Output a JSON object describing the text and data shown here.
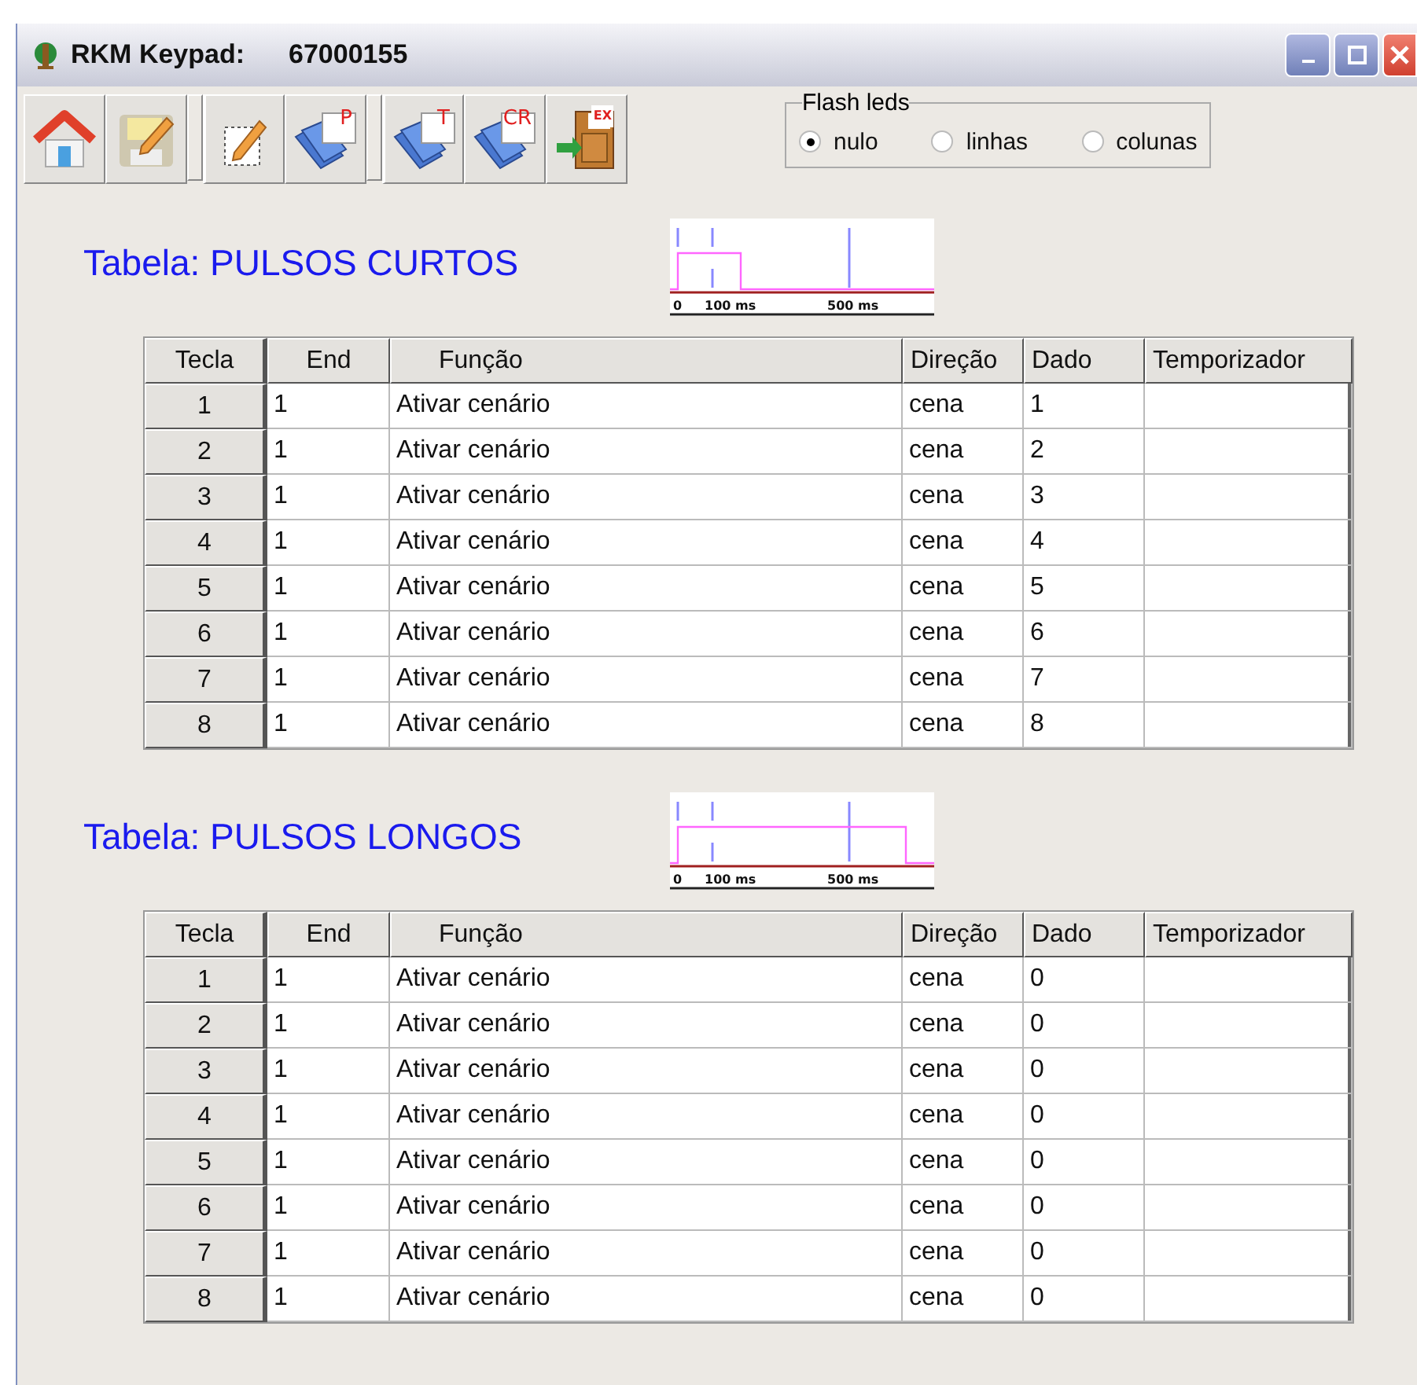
{
  "window": {
    "title": "RKM Keypad:",
    "serial": "67000155"
  },
  "toolbar": [
    {
      "kind": "home",
      "separator_before": false
    },
    {
      "kind": "save",
      "separator_before": false
    },
    {
      "kind": "edit",
      "separator_before": true
    },
    {
      "kind": "folder",
      "badge": "P",
      "separator_before": false
    },
    {
      "kind": "folder",
      "badge": "T",
      "separator_before": true
    },
    {
      "kind": "folder",
      "badge": "CR",
      "separator_before": false
    },
    {
      "kind": "exit",
      "badge": "EX",
      "separator_before": false
    }
  ],
  "flash_leds": {
    "label": "Flash leds",
    "options": [
      {
        "label": "nulo",
        "selected": true
      },
      {
        "label": "linhas",
        "selected": false
      },
      {
        "label": "colunas",
        "selected": false
      }
    ]
  },
  "tables": [
    {
      "title": "Tabela: PULSOS CURTOS",
      "pulse": {
        "kind": "short",
        "ticks": [
          "0",
          "100 ms",
          "500 ms"
        ]
      },
      "columns": [
        "Tecla",
        "End",
        "Função",
        "Direção",
        "Dado",
        "Temporizador"
      ],
      "rows": [
        [
          "1",
          "1",
          "Ativar cenário",
          "cena",
          "1",
          ""
        ],
        [
          "2",
          "1",
          "Ativar cenário",
          "cena",
          "2",
          ""
        ],
        [
          "3",
          "1",
          "Ativar cenário",
          "cena",
          "3",
          ""
        ],
        [
          "4",
          "1",
          "Ativar cenário",
          "cena",
          "4",
          ""
        ],
        [
          "5",
          "1",
          "Ativar cenário",
          "cena",
          "5",
          ""
        ],
        [
          "6",
          "1",
          "Ativar cenário",
          "cena",
          "6",
          ""
        ],
        [
          "7",
          "1",
          "Ativar cenário",
          "cena",
          "7",
          ""
        ],
        [
          "8",
          "1",
          "Ativar cenário",
          "cena",
          "8",
          ""
        ]
      ]
    },
    {
      "title": "Tabela: PULSOS LONGOS",
      "pulse": {
        "kind": "long",
        "ticks": [
          "0",
          "100 ms",
          "500 ms"
        ]
      },
      "columns": [
        "Tecla",
        "End",
        "Função",
        "Direção",
        "Dado",
        "Temporizador"
      ],
      "rows": [
        [
          "1",
          "1",
          "Ativar cenário",
          "cena",
          "0",
          ""
        ],
        [
          "2",
          "1",
          "Ativar cenário",
          "cena",
          "0",
          ""
        ],
        [
          "3",
          "1",
          "Ativar cenário",
          "cena",
          "0",
          ""
        ],
        [
          "4",
          "1",
          "Ativar cenário",
          "cena",
          "0",
          ""
        ],
        [
          "5",
          "1",
          "Ativar cenário",
          "cena",
          "0",
          ""
        ],
        [
          "6",
          "1",
          "Ativar cenário",
          "cena",
          "0",
          ""
        ],
        [
          "7",
          "1",
          "Ativar cenário",
          "cena",
          "0",
          ""
        ],
        [
          "8",
          "1",
          "Ativar cenário",
          "cena",
          "0",
          ""
        ]
      ]
    }
  ]
}
